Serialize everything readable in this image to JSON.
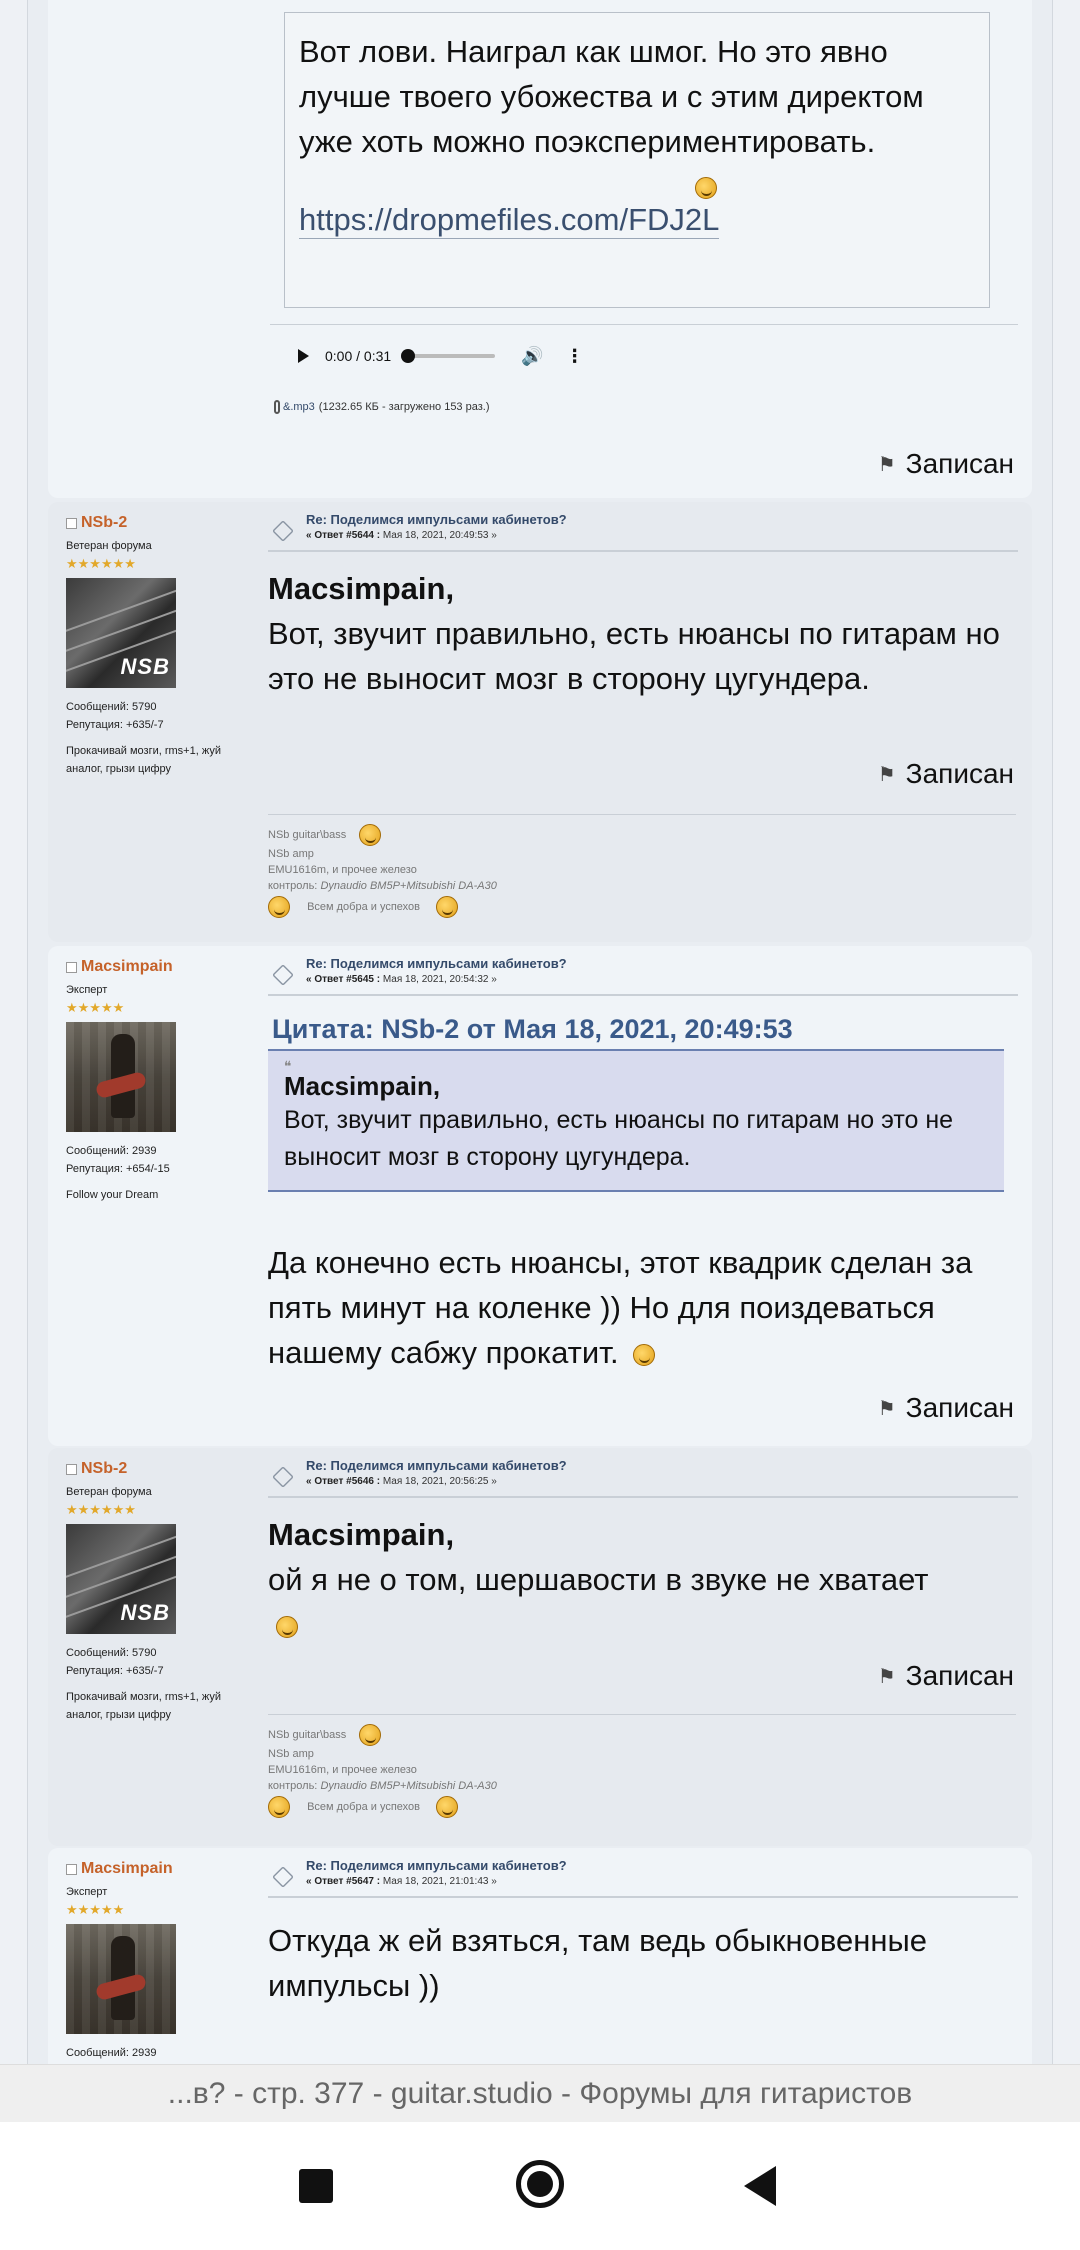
{
  "post0": {
    "text": "Вот лови. Наиграл как шмог. Но это явно лучше твоего убожества и с этим директом уже хоть можно поэкспериментировать.",
    "link": "https://dropmefiles.com/FDJ2L",
    "audio_time": "0:00 / 0:31",
    "attachment": "&.mp3",
    "attachment_info": "(1232.65 КБ - загружено 153 раз.)",
    "saved": "Записан"
  },
  "post1": {
    "author": "NSb-2",
    "rank": "Ветеран форума",
    "stars": "★★★★★★",
    "avatar_text": "NSB",
    "msgs": "Сообщений: 5790",
    "rep": "Репутация: +635/-7",
    "psig": "Прокачивай мозги, rms+1, жуй аналог, грызи цифру",
    "subject": "Re: Поделимся импульсами кабинетов?",
    "reply_label": "« Ответ #5644 :",
    "date": "Мая 18, 2021, 20:49:53 »",
    "addressee": "Macsimpain,",
    "body": "Вот, звучит правильно, есть нюансы по гитарам но это не выносит мозг в сторону цугундера.",
    "saved": "Записан",
    "sig1": "NSb guitar\\bass",
    "sig2": "NSb amp",
    "sig3": "EMU1616m, и прочее железо",
    "sig4_label": "контроль:",
    "sig4_value": "Dynaudio BM5P+Mitsubishi DA-A30",
    "sig5": "Всем добра и успехов"
  },
  "post2": {
    "author": "Macsimpain",
    "rank": "Эксперт",
    "stars": "★★★★★",
    "msgs": "Сообщений: 2939",
    "rep": "Репутация: +654/-15",
    "psig": "Follow your Dream",
    "subject": "Re: Поделимся импульсами кабинетов?",
    "reply_label": "« Ответ #5645 :",
    "date": "Мая 18, 2021, 20:54:32 »",
    "quote_header": "Цитата: NSb-2 от Мая 18, 2021, 20:49:53",
    "quote_name": "Macsimpain,",
    "quote_body": "Вот, звучит правильно, есть нюансы по гитарам но это не выносит мозг в сторону цугундера.",
    "body": "Да конечно есть нюансы, этот квадрик сделан за пять минут на коленке )) Но для поиздеваться нашему сабжу прокатит.",
    "saved": "Записан"
  },
  "post3": {
    "author": "NSb-2",
    "rank": "Ветеран форума",
    "stars": "★★★★★★",
    "avatar_text": "NSB",
    "msgs": "Сообщений: 5790",
    "rep": "Репутация: +635/-7",
    "psig": "Прокачивай мозги, rms+1, жуй аналог, грызи цифру",
    "subject": "Re: Поделимся импульсами кабинетов?",
    "reply_label": "« Ответ #5646 :",
    "date": "Мая 18, 2021, 20:56:25 »",
    "addressee": "Macsimpain,",
    "body": "ой я не о том, шершавости в звуке не хватает",
    "saved": "Записан",
    "sig1": "NSb guitar\\bass",
    "sig2": "NSb amp",
    "sig3": "EMU1616m, и прочее железо",
    "sig4_label": "контроль:",
    "sig4_value": "Dynaudio BM5P+Mitsubishi DA-A30",
    "sig5": "Всем добра и успехов"
  },
  "post4": {
    "author": "Macsimpain",
    "rank": "Эксперт",
    "stars": "★★★★★",
    "msgs": "Сообщений: 2939",
    "subject": "Re: Поделимся импульсами кабинетов?",
    "reply_label": "« Ответ #5647 :",
    "date": "Мая 18, 2021, 21:01:43 »",
    "body": "Откуда ж ей взяться, там ведь обыкновенные импульсы ))"
  },
  "tab_title": "...в? - стр. 377 - guitar.studio - Форумы для гитаристов"
}
